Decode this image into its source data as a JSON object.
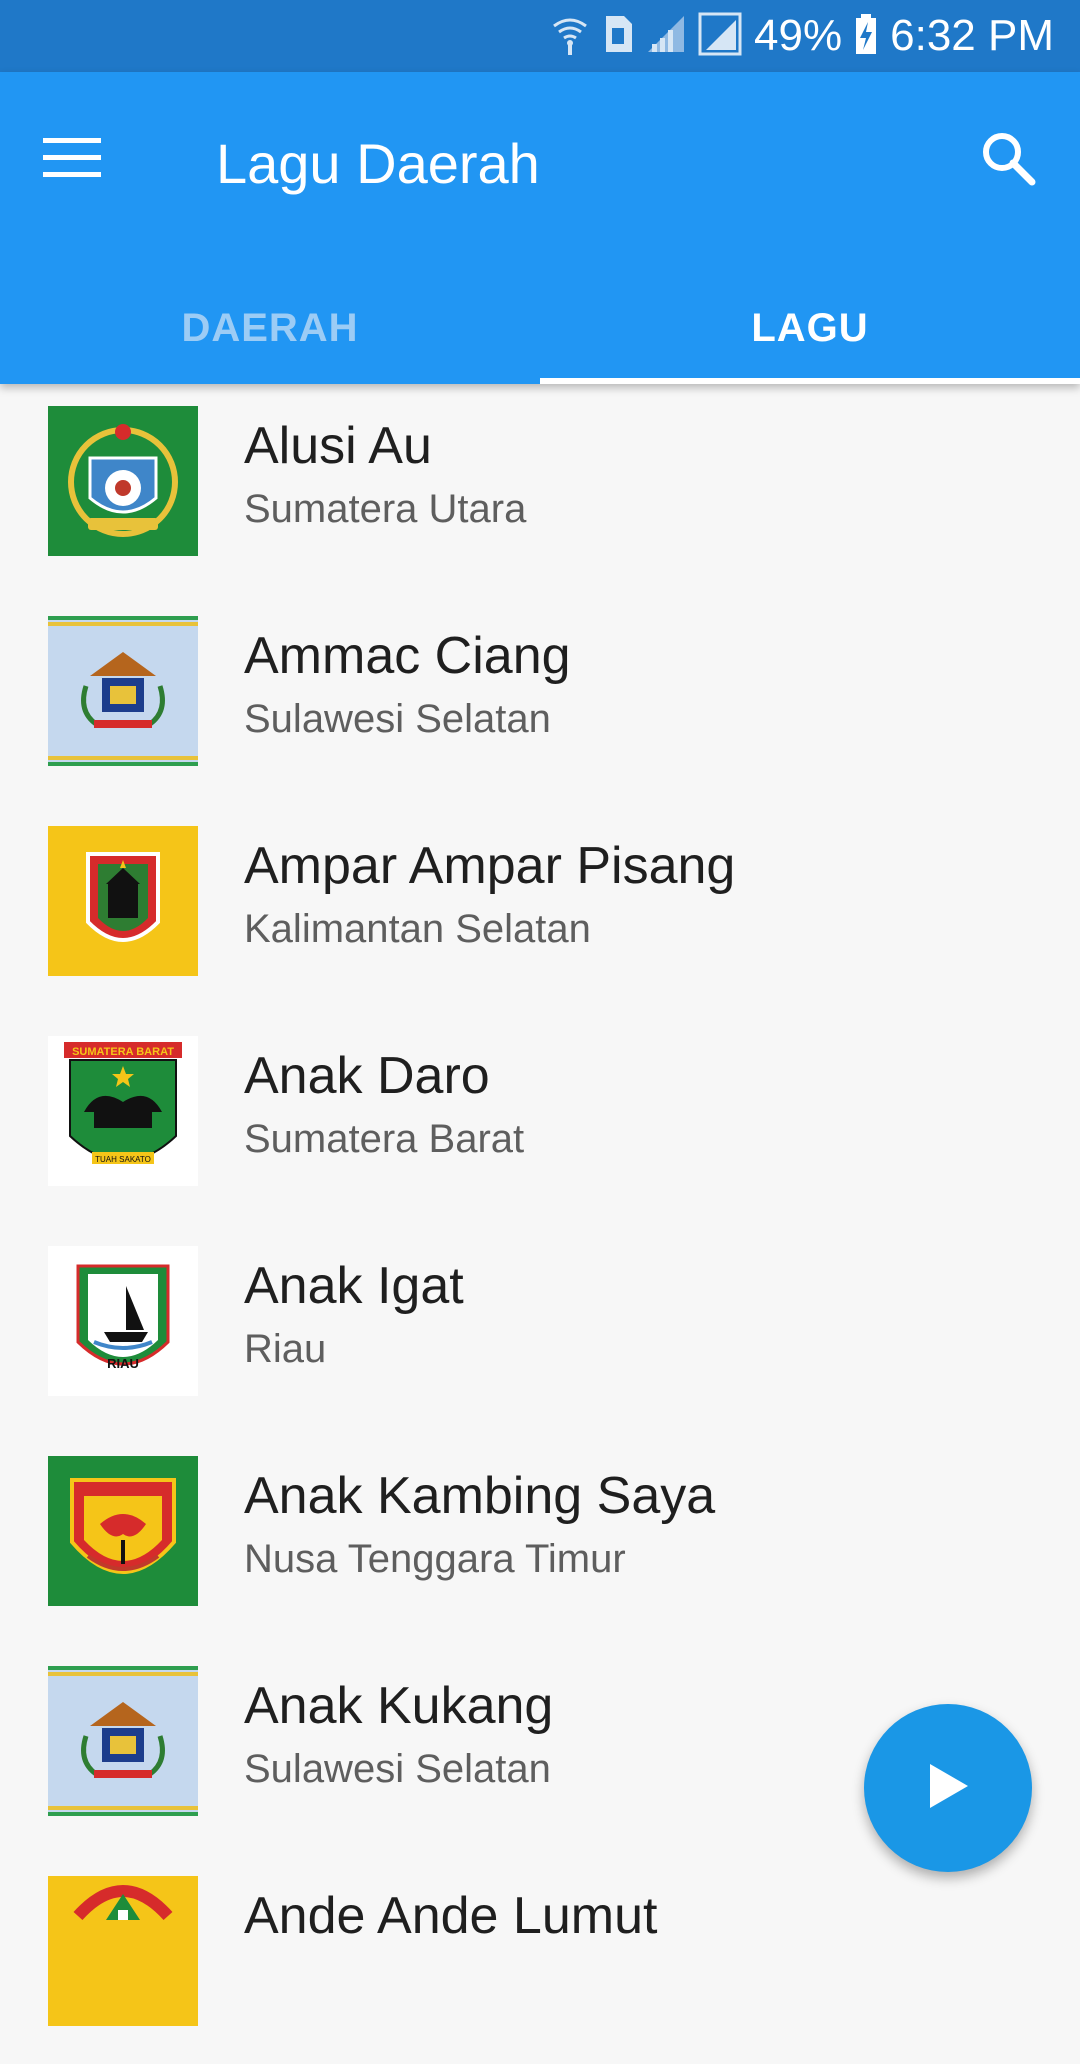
{
  "status_bar": {
    "battery_percent": "49%",
    "time": "6:32 PM",
    "icons": [
      "wifi-icon",
      "sim-icon",
      "signal-icon",
      "signal-box-icon",
      "battery-charging-icon"
    ]
  },
  "app_bar": {
    "title": "Lagu Daerah",
    "menu_icon": "hamburger-menu-icon",
    "search_icon": "search-icon",
    "background": "#2196f3"
  },
  "tabs": [
    {
      "label": "DAERAH",
      "active": false
    },
    {
      "label": "LAGU",
      "active": true
    }
  ],
  "songs": [
    {
      "title": "Alusi Au",
      "region": "Sumatera Utara",
      "emblem": "sumatera-utara-emblem",
      "bg": "#1e8c3a"
    },
    {
      "title": "Ammac Ciang",
      "region": "Sulawesi Selatan",
      "emblem": "sulawesi-selatan-emblem",
      "bg": "#c5d8ee"
    },
    {
      "title": "Ampar Ampar Pisang",
      "region": "Kalimantan Selatan",
      "emblem": "kalimantan-selatan-emblem",
      "bg": "#f5c518"
    },
    {
      "title": "Anak Daro",
      "region": "Sumatera Barat",
      "emblem": "sumatera-barat-emblem",
      "bg": "#ffffff"
    },
    {
      "title": "Anak Igat",
      "region": "Riau",
      "emblem": "riau-emblem",
      "bg": "#ffffff"
    },
    {
      "title": "Anak Kambing Saya",
      "region": "Nusa Tenggara Timur",
      "emblem": "nusa-tenggara-timur-emblem",
      "bg": "#1e8c3a"
    },
    {
      "title": "Anak Kukang",
      "region": "Sulawesi Selatan",
      "emblem": "sulawesi-selatan-emblem",
      "bg": "#c5d8ee"
    },
    {
      "title": "Ande Ande Lumut",
      "region": "",
      "emblem": "jawa-timur-emblem",
      "bg": "#f5c518"
    }
  ],
  "fab": {
    "icon": "play-icon",
    "color": "#1a97e6"
  },
  "emblem_texts": {
    "sumatera_barat": "SUMATERA BARAT",
    "sumatera_barat_motto": "TUAH SAKATO",
    "riau": "RIAU"
  }
}
